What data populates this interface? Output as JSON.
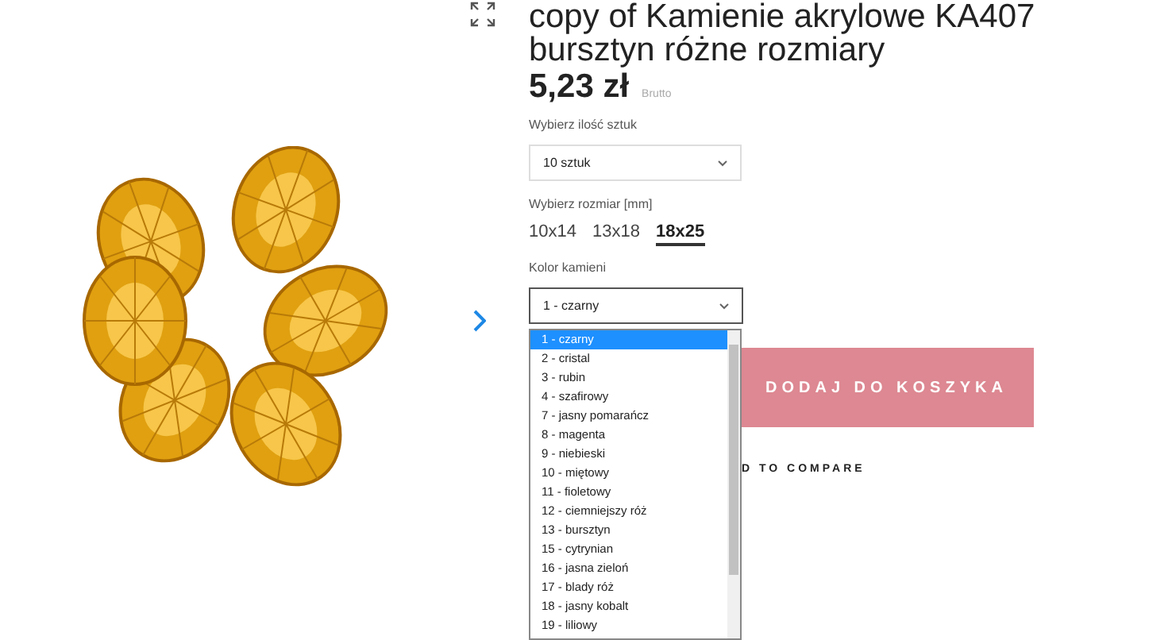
{
  "product": {
    "title_lines": [
      "copy of Kamienie akrylowe KA407",
      "bursztyn różne rozmiary"
    ],
    "price": "5,23 zł",
    "price_note": "Brutto"
  },
  "quantity": {
    "label": "Wybierz ilość sztuk",
    "value": "10 sztuk"
  },
  "size": {
    "label": "Wybierz rozmiar [mm]",
    "options": [
      {
        "label": "10x14",
        "selected": false
      },
      {
        "label": "13x18",
        "selected": false
      },
      {
        "label": "18x25",
        "selected": true
      }
    ]
  },
  "color": {
    "label": "Kolor kamieni",
    "value": "1 - czarny",
    "expanded": true,
    "options": [
      {
        "label": "1 - czarny",
        "selected": true
      },
      {
        "label": "2 - cristal",
        "selected": false
      },
      {
        "label": "3 - rubin",
        "selected": false
      },
      {
        "label": "4 - szafirowy",
        "selected": false
      },
      {
        "label": "7 - jasny pomarańcz",
        "selected": false
      },
      {
        "label": "8 - magenta",
        "selected": false
      },
      {
        "label": "9 - niebieski",
        "selected": false
      },
      {
        "label": "10 - miętowy",
        "selected": false
      },
      {
        "label": "11 - fioletowy",
        "selected": false
      },
      {
        "label": "12 - ciemniejszy róż",
        "selected": false
      },
      {
        "label": "13 - bursztyn",
        "selected": false
      },
      {
        "label": "15 - cytrynian",
        "selected": false
      },
      {
        "label": "16 - jasna zieloń",
        "selected": false
      },
      {
        "label": "17 - blady róż",
        "selected": false
      },
      {
        "label": "18 - jasny kobalt",
        "selected": false
      },
      {
        "label": "19 - liliowy",
        "selected": false
      }
    ]
  },
  "add_to_cart": "DODAJ DO KOSZYKA",
  "compare": "D TO COMPARE"
}
